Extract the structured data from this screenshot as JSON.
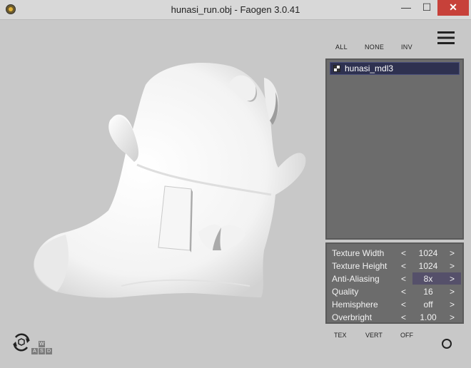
{
  "window": {
    "title": "hunasi_run.obj - Faogen 3.0.41",
    "min_label": "—",
    "max_label": "☐",
    "close_label": "✕"
  },
  "toolbar": {
    "icons": [
      "folder-open-icon",
      "save-icon",
      "wireframe-cube-icon",
      "move-cross-icon",
      "solid-cube-icon",
      "ghost-cube-icon",
      "gear-icon"
    ],
    "menu_icon": "hamburger-menu-icon"
  },
  "selection": {
    "all": "ALL",
    "none": "NONE",
    "inv": "INV"
  },
  "meshes": [
    {
      "name": "hunasi_mdl3",
      "checked": true
    }
  ],
  "settings": [
    {
      "label": "Texture Width",
      "value": "1024"
    },
    {
      "label": "Texture Height",
      "value": "1024"
    },
    {
      "label": "Anti-Aliasing",
      "value": "8x"
    },
    {
      "label": "Quality",
      "value": "16"
    },
    {
      "label": "Hemisphere",
      "value": "off"
    },
    {
      "label": "Overbright",
      "value": "1.00"
    }
  ],
  "arrows": {
    "left": "<",
    "right": ">"
  },
  "view_modes": {
    "tex": "TEX",
    "vert": "VERT",
    "off": "OFF"
  },
  "keys": [
    "W",
    "A",
    "S",
    "D"
  ],
  "colors": {
    "background": "#c8c8c8",
    "panel": "#6c6c6c",
    "selected_item": "#2e3150",
    "close_button": "#c7413a",
    "highlight_row": "#55506a"
  }
}
